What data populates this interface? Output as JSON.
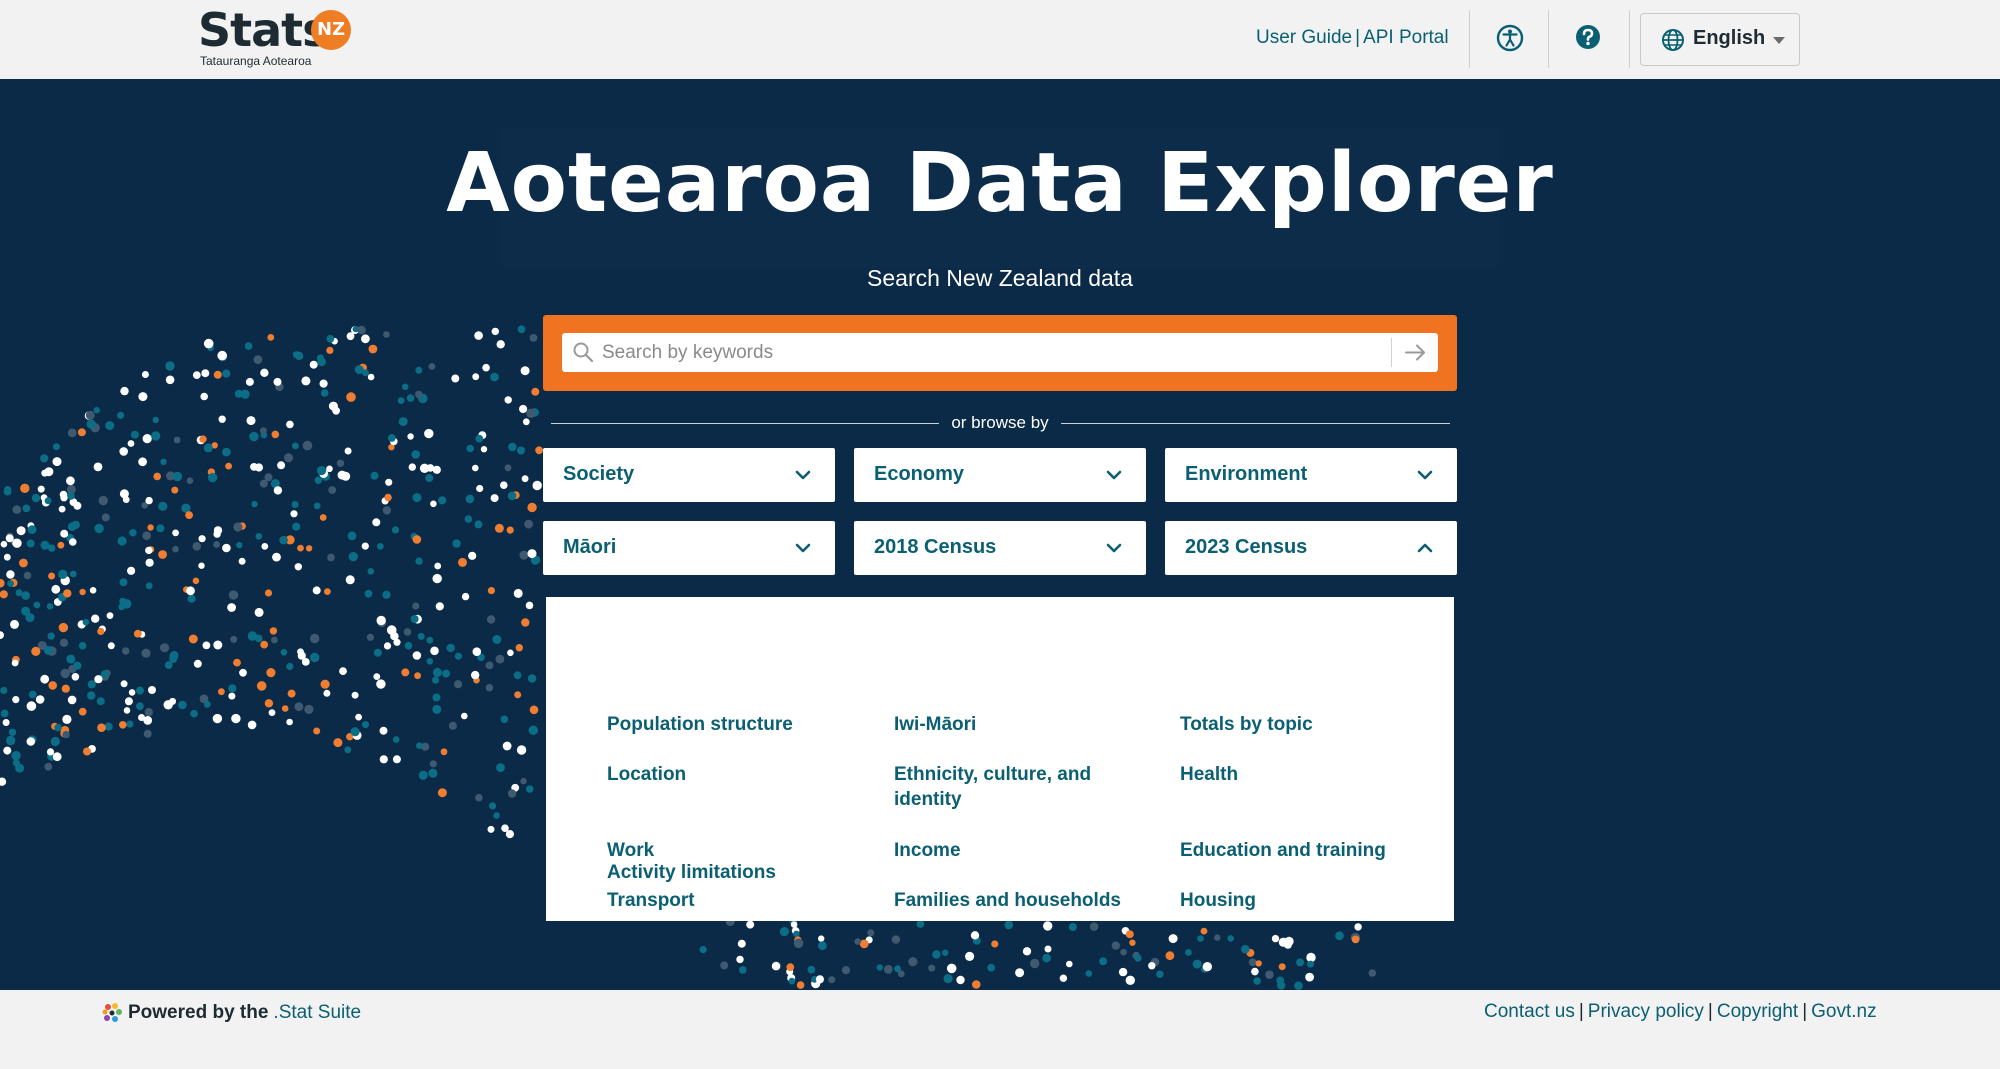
{
  "header": {
    "logo_word": "Stats",
    "logo_badge": "NZ",
    "logo_sub": "Tatauranga Aotearoa",
    "links": [
      "User Guide",
      "API Portal"
    ],
    "link_sep": "|",
    "accessibility_icon": "accessibility-icon",
    "help_icon": "help-icon",
    "language": "English"
  },
  "hero": {
    "title": "Aotearoa Data Explorer",
    "subtitle": "Search New Zealand data",
    "search_placeholder": "Search by keywords",
    "browse_label": "or browse by"
  },
  "dropdowns": [
    {
      "label": "Society",
      "expanded": false
    },
    {
      "label": "Economy",
      "expanded": false
    },
    {
      "label": "Environment",
      "expanded": false
    },
    {
      "label": "Māori",
      "expanded": false
    },
    {
      "label": "2018 Census",
      "expanded": false
    },
    {
      "label": "2023 Census",
      "expanded": true
    }
  ],
  "census_panel": {
    "items": [
      "Population structure",
      "Iwi-Māori",
      "Totals by topic",
      "Location",
      "Ethnicity, culture, and identity",
      "Health",
      "Work",
      "Income",
      "Education and training",
      "Transport",
      "Families and households",
      "Housing",
      "Activity limitations"
    ]
  },
  "footer": {
    "powered_text": "Powered by the",
    "powered_link": ".Stat Suite",
    "links": [
      "Contact us",
      "Privacy policy",
      "Copyright",
      "Govt.nz"
    ],
    "link_sep": "|"
  },
  "colors": {
    "navy": "#0a2a47",
    "orange": "#ef7320",
    "teal": "#0a5f73",
    "dot_white": "#ffffff",
    "dot_orange": "#ef7d32",
    "dot_teal": "#0b6e86",
    "dot_grey": "#3f5a70"
  }
}
